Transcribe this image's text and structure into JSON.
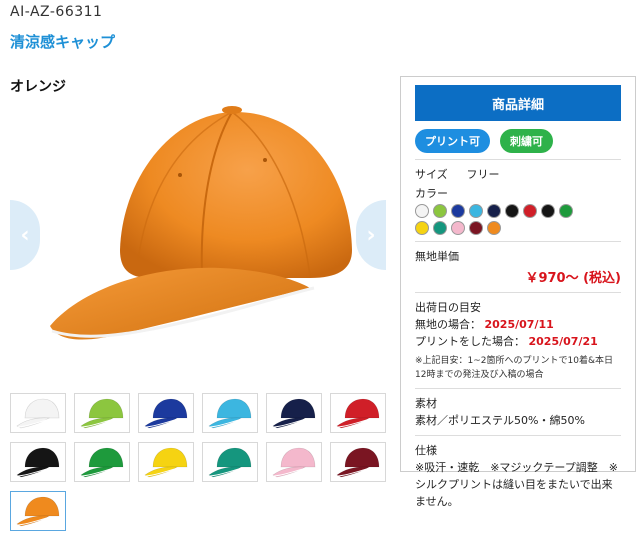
{
  "product": {
    "code": "AI-AZ-66311",
    "name": "清涼感キャップ",
    "selected_color": "オレンジ"
  },
  "gallery": {
    "prev_icon": "chevron-left-icon",
    "next_icon": "chevron-right-icon",
    "thumbnails": [
      {
        "color": "#f4f4f4",
        "name": "white"
      },
      {
        "color": "#8cc63f",
        "name": "lime"
      },
      {
        "color": "#1c3a9e",
        "name": "royal-blue"
      },
      {
        "color": "#3cb6e0",
        "name": "sky-blue"
      },
      {
        "color": "#16204a",
        "name": "navy"
      },
      {
        "color": "#d01f28",
        "name": "red"
      },
      {
        "color": "#151515",
        "name": "black"
      },
      {
        "color": "#1e9a3c",
        "name": "green"
      },
      {
        "color": "#f5d312",
        "name": "yellow"
      },
      {
        "color": "#15967e",
        "name": "teal-green"
      },
      {
        "color": "#f4b8cc",
        "name": "pink"
      },
      {
        "color": "#7a1522",
        "name": "burgundy"
      },
      {
        "color": "#ef8a1e",
        "name": "orange"
      }
    ],
    "selected_index": 12
  },
  "panel": {
    "header": "商品詳細",
    "badges": {
      "print": "プリント可",
      "embroidery": "刺繍可"
    },
    "size_label": "サイズ",
    "size_value": "フリー",
    "color_label": "カラー",
    "swatches": [
      "#f4f4f4",
      "#8cc63f",
      "#1c3a9e",
      "#3cb6e0",
      "#16204a",
      "#151515",
      "#d01f28",
      "#151515",
      "#1e9a3c",
      "#f5d312",
      "#15967e",
      "#f4b8cc",
      "#7a1522",
      "#ef8a1e"
    ],
    "unit_price_label": "無地単価",
    "unit_price": "￥970～ (税込)",
    "ship_title": "出荷日の目安",
    "ship_plain_label": "無地の場合：",
    "ship_plain_date": "2025/07/11",
    "ship_print_label": "プリントをした場合：",
    "ship_print_date": "2025/07/21",
    "ship_note": "※上記目安：1~2箇所へのプリントで10着&本日12時までの発注及び入稿の場合",
    "material_title": "素材",
    "material_value": "素材／ポリエステル50%・綿50%",
    "spec_title": "仕様",
    "spec_value": "※吸汗・速乾　※マジックテープ調整　※シルクプリントは縫い目をまたいで出来ません。"
  }
}
